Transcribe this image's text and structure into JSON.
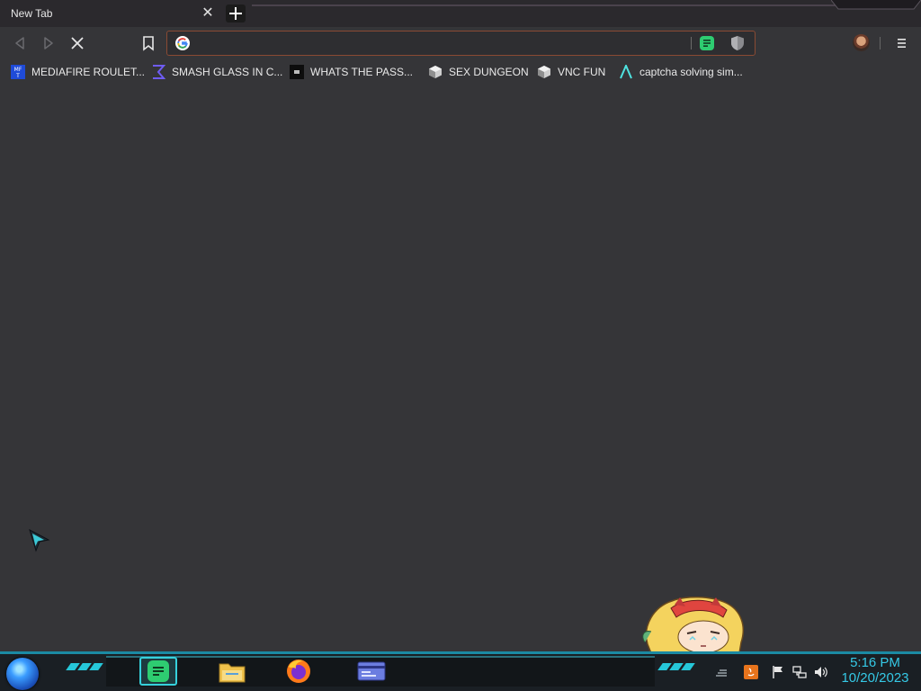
{
  "browser": {
    "tab": {
      "title": "New Tab",
      "close_icon": "close-icon"
    },
    "new_tab_icon": "plus-icon",
    "toolbar": {
      "back_icon": "back-arrow-icon",
      "forward_icon": "forward-arrow-icon",
      "stop_icon": "stop-loading-icon",
      "bookmark_icon": "bookmark-icon",
      "menu_icon": "menu-icon"
    },
    "omnibox": {
      "value": "",
      "placeholder": "",
      "engine_icon": "google-icon"
    },
    "bookmarks": [
      {
        "label": "MEDIAFIRE ROULET...",
        "icon": "mediafire-icon"
      },
      {
        "label": "SMASH GLASS IN C...",
        "icon": "sigma-icon"
      },
      {
        "label": "WHATS THE PASS...",
        "icon": "dark-square-icon"
      },
      {
        "label": "SEX DUNGEON",
        "icon": "cube-icon"
      },
      {
        "label": "VNC FUN",
        "icon": "cube-icon"
      },
      {
        "label": "captcha solving sim...",
        "icon": "lambda-icon"
      }
    ]
  },
  "taskbar": {
    "apps": [
      {
        "name": "messages-app",
        "active": true
      },
      {
        "name": "file-explorer",
        "active": false
      },
      {
        "name": "firefox",
        "active": false
      },
      {
        "name": "id-card-app",
        "active": false
      }
    ],
    "clock": {
      "time": "5:16 PM",
      "date": "10/20/2023"
    }
  },
  "colors": {
    "accent": "#36d1dc",
    "background": "#353538",
    "omnibox_border": "#8a4a33"
  }
}
